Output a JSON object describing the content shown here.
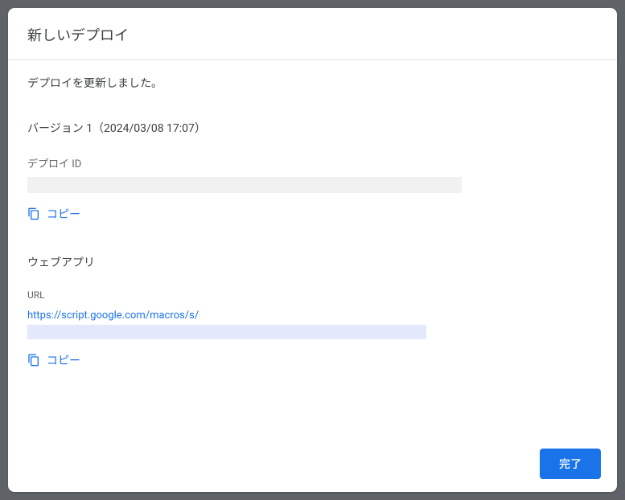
{
  "dialog": {
    "title": "新しいデプロイ",
    "status": "デプロイを更新しました。",
    "version_label": "バージョン 1（2024/03/08 17:07）",
    "deploy_id_label": "デプロイ ID",
    "copy_label": "コピー",
    "webapp_label": "ウェブアプリ",
    "url_label": "URL",
    "url_prefix": "https://script.google.com/macros/s/",
    "done_label": "完了"
  }
}
